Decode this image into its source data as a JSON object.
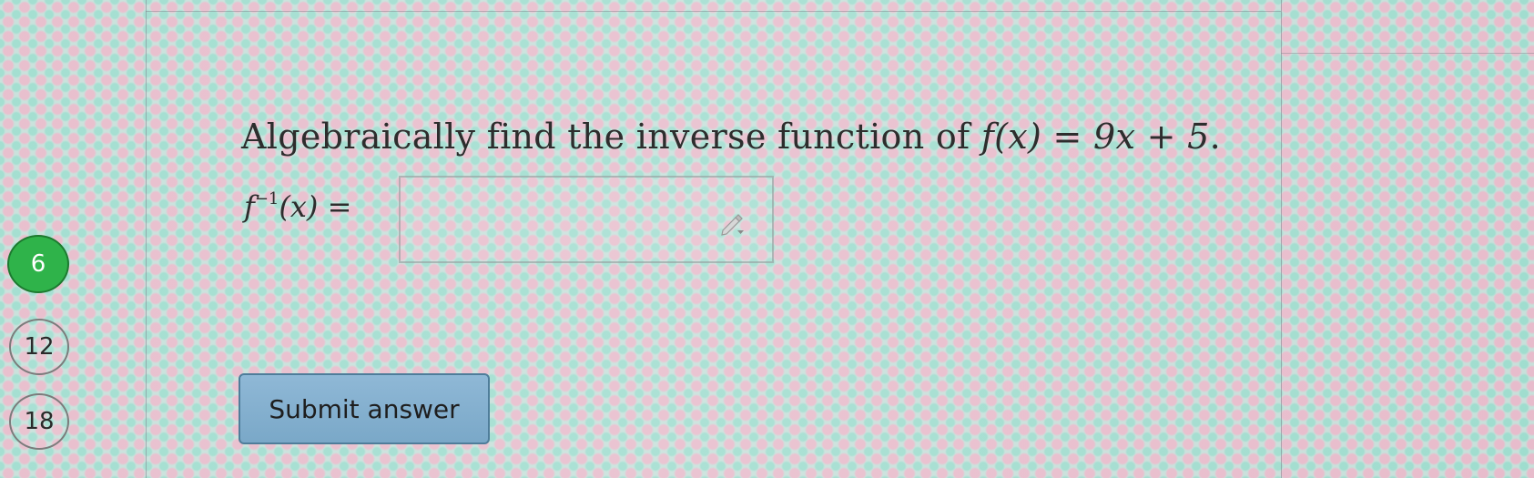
{
  "nav": {
    "items": [
      {
        "label": "6",
        "active": true
      },
      {
        "label": "12",
        "active": false
      },
      {
        "label": "18",
        "active": false
      }
    ]
  },
  "question": {
    "prefix": "Algebraically find the inverse function of ",
    "function": "f(x) = 9x + 5",
    "suffix": "."
  },
  "answer": {
    "label_base": "f",
    "label_sup": "−1",
    "label_rest": "(x) =",
    "value": "",
    "icon": "pencil-icon"
  },
  "submit": {
    "label": "Submit answer"
  },
  "colors": {
    "active_nav": "#2fb34a",
    "submit_button": "#8fb8d6"
  }
}
